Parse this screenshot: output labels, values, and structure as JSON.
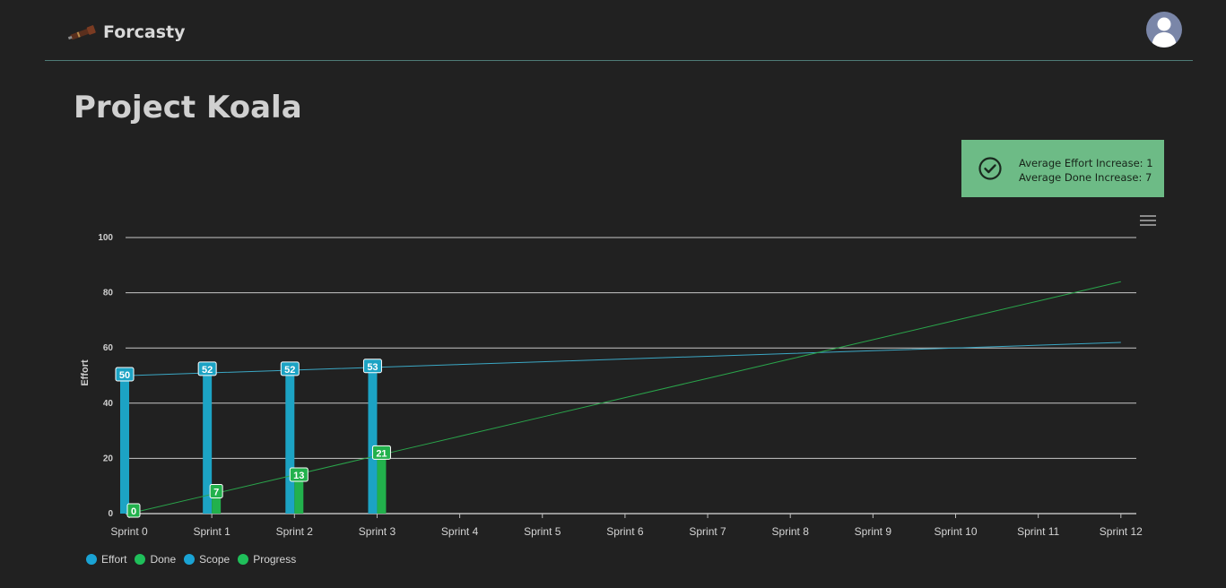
{
  "app": {
    "name": "Forcasty",
    "logo_icon": "telescope-icon",
    "avatar_icon": "user-avatar-icon"
  },
  "page": {
    "title": "Project Koala"
  },
  "stats": {
    "icon": "check-circle-icon",
    "effort_increase": "Average Effort Increase: 1",
    "done_increase": "Average Done Increase: 7",
    "background": "#6dbb86"
  },
  "chart_menu": {
    "icon": "hamburger-menu-icon"
  },
  "colors": {
    "effort": "#1ca3c4",
    "done": "#22b14c",
    "scope": "#3ba7c4",
    "progress": "#2aa54b"
  },
  "legend": [
    {
      "label": "Effort",
      "color": "#1aa3d4"
    },
    {
      "label": "Done",
      "color": "#1fbf5a"
    },
    {
      "label": "Scope",
      "color": "#1aa3d4"
    },
    {
      "label": "Progress",
      "color": "#1fbf5a"
    }
  ],
  "chart_data": {
    "type": "bar",
    "categories": [
      "Sprint 0",
      "Sprint 1",
      "Sprint 2",
      "Sprint 3",
      "Sprint 4",
      "Sprint 5",
      "Sprint 6",
      "Sprint 7",
      "Sprint 8",
      "Sprint 9",
      "Sprint 10",
      "Sprint 11",
      "Sprint 12"
    ],
    "ylabel": "Effort",
    "ylim": [
      0,
      100
    ],
    "yticks": [
      0,
      20,
      40,
      60,
      80,
      100
    ],
    "grid": true,
    "legend_position": "bottom-left",
    "series": [
      {
        "name": "Effort",
        "type": "bar",
        "values": [
          50,
          52,
          52,
          53,
          null,
          null,
          null,
          null,
          null,
          null,
          null,
          null,
          null
        ]
      },
      {
        "name": "Done",
        "type": "bar",
        "values": [
          0,
          7,
          13,
          21,
          null,
          null,
          null,
          null,
          null,
          null,
          null,
          null,
          null
        ]
      },
      {
        "name": "Scope",
        "type": "line",
        "values": [
          50,
          51,
          52,
          53,
          54,
          55,
          56,
          57,
          58,
          59,
          60,
          61,
          62
        ]
      },
      {
        "name": "Progress",
        "type": "line",
        "values": [
          0,
          7,
          14,
          21,
          28,
          35,
          42,
          49,
          56,
          63,
          70,
          77,
          84
        ]
      }
    ]
  }
}
